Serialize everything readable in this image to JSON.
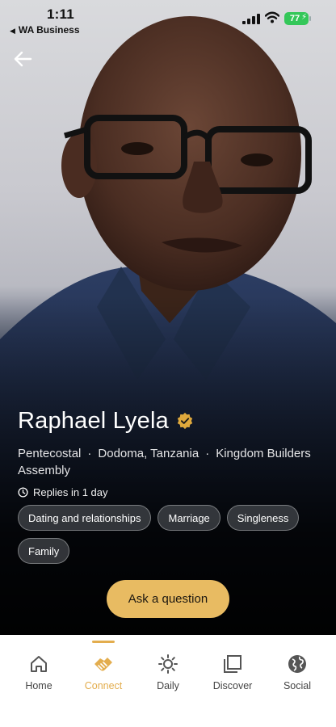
{
  "status_bar": {
    "time": "1:11",
    "back_app_label": "WA Business",
    "battery": "77"
  },
  "profile": {
    "name": "Raphael Lyela",
    "verified": true,
    "denomination": "Pentecostal",
    "location": "Dodoma, Tanzania",
    "church_line1": "Kingdom Builders",
    "church_line2": "Assembly",
    "separator": "·",
    "replies": "Replies in 1 day"
  },
  "tags": [
    "Dating and relationships",
    "Marriage",
    "Singleness",
    "Family"
  ],
  "cta": {
    "label": "Ask a question"
  },
  "nav": {
    "items": [
      {
        "label": "Home",
        "icon": "home-icon"
      },
      {
        "label": "Connect",
        "icon": "handshake-icon",
        "active": true
      },
      {
        "label": "Daily",
        "icon": "sun-icon"
      },
      {
        "label": "Discover",
        "icon": "stacked-squares-icon"
      },
      {
        "label": "Social",
        "icon": "globe-icon"
      }
    ]
  },
  "colors": {
    "accent": "#e3ad4e",
    "button": "#e8bb62",
    "verified_badge": "#e0a93c",
    "battery": "#34c759"
  }
}
